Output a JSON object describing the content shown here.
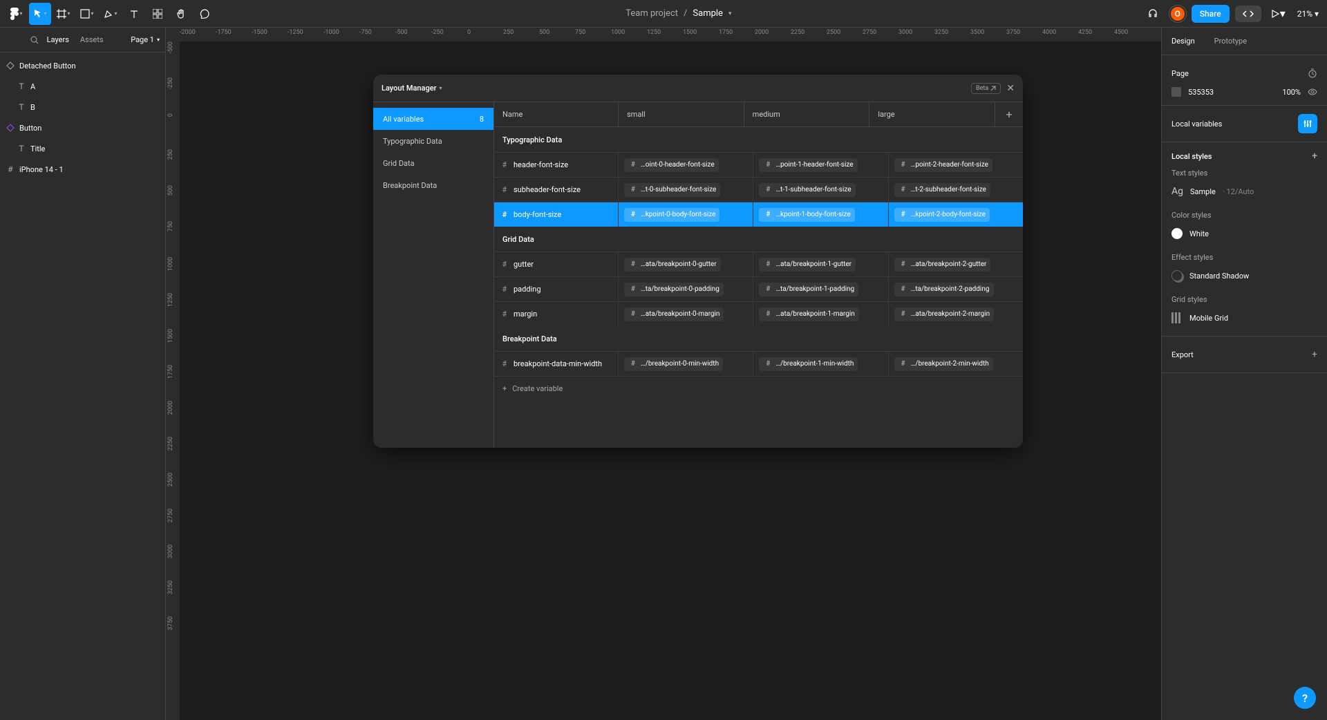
{
  "toolbar": {
    "team": "Team project",
    "file": "Sample",
    "avatar_letter": "O",
    "share": "Share",
    "zoom": "21%"
  },
  "left_panel": {
    "tabs": {
      "layers": "Layers",
      "assets": "Assets"
    },
    "page_label": "Page 1",
    "tree": [
      {
        "label": "Detached Button",
        "icon": "component",
        "indent": 0
      },
      {
        "label": "A",
        "icon": "text",
        "indent": 1
      },
      {
        "label": "B",
        "icon": "text",
        "indent": 1
      },
      {
        "label": "Button",
        "icon": "component",
        "indent": 0,
        "comp": true
      },
      {
        "label": "Title",
        "icon": "text",
        "indent": 1
      },
      {
        "label": "iPhone 14 - 1",
        "icon": "frame",
        "indent": 0
      }
    ]
  },
  "ruler_h": [
    "-2000",
    "-1750",
    "-1500",
    "-1250",
    "-1000",
    "-750",
    "-500",
    "-250",
    "0",
    "250",
    "500",
    "750",
    "1000",
    "1250",
    "1500",
    "1750",
    "2000",
    "2250",
    "2500",
    "2750",
    "3000",
    "3250",
    "3500",
    "3750",
    "4000",
    "4250",
    "4500"
  ],
  "ruler_v": [
    "-500",
    "-250",
    "0",
    "250",
    "500",
    "750",
    "1000",
    "1250",
    "1500",
    "1750",
    "2000",
    "2250",
    "2500",
    "2750",
    "3000",
    "3250",
    "3750"
  ],
  "modal": {
    "title": "Layout Manager",
    "beta": "Beta",
    "sidebar": {
      "all": {
        "label": "All variables",
        "count": "8"
      },
      "groups": [
        "Typographic Data",
        "Grid Data",
        "Breakpoint Data"
      ]
    },
    "columns": [
      "Name",
      "small",
      "medium",
      "large"
    ],
    "sections": [
      {
        "title": "Typographic Data",
        "rows": [
          {
            "name": "header-font-size",
            "small": "…oint-0-header-font-size",
            "medium": "…point-1-header-font-size",
            "large": "…point-2-header-font-size"
          },
          {
            "name": "subheader-font-size",
            "small": "…t-0-subheader-font-size",
            "medium": "…t-1-subheader-font-size",
            "large": "…t-2-subheader-font-size"
          },
          {
            "name": "body-font-size",
            "small": "…kpoint-0-body-font-size",
            "medium": "…kpoint-1-body-font-size",
            "large": "…kpoint-2-body-font-size",
            "selected": true
          }
        ]
      },
      {
        "title": "Grid Data",
        "rows": [
          {
            "name": "gutter",
            "small": "…ata/breakpoint-0-gutter",
            "medium": "…ata/breakpoint-1-gutter",
            "large": "…ata/breakpoint-2-gutter"
          },
          {
            "name": "padding",
            "small": "…ta/breakpoint-0-padding",
            "medium": "…ta/breakpoint-1-padding",
            "large": "…ta/breakpoint-2-padding"
          },
          {
            "name": "margin",
            "small": "…ata/breakpoint-0-margin",
            "medium": "…ata/breakpoint-1-margin",
            "large": "…ata/breakpoint-2-margin"
          }
        ]
      },
      {
        "title": "Breakpoint Data",
        "rows": [
          {
            "name": "breakpoint-data-min-width",
            "small": "…/breakpoint-0-min-width",
            "medium": "…/breakpoint-1-min-width",
            "large": "…/breakpoint-2-min-width"
          }
        ]
      }
    ],
    "create": "Create variable"
  },
  "right_panel": {
    "tabs": {
      "design": "Design",
      "prototype": "Prototype"
    },
    "page_label": "Page",
    "bg_hex": "535353",
    "bg_opacity": "100%",
    "local_vars": "Local variables",
    "local_styles": "Local styles",
    "text_styles": {
      "header": "Text styles",
      "ag": "Ag",
      "name": "Sample",
      "detail": "· 12/Auto"
    },
    "color_styles": {
      "header": "Color styles",
      "name": "White"
    },
    "effect_styles": {
      "header": "Effect styles",
      "name": "Standard Shadow"
    },
    "grid_styles": {
      "header": "Grid styles",
      "name": "Mobile Grid"
    },
    "export": "Export"
  },
  "help": "?"
}
